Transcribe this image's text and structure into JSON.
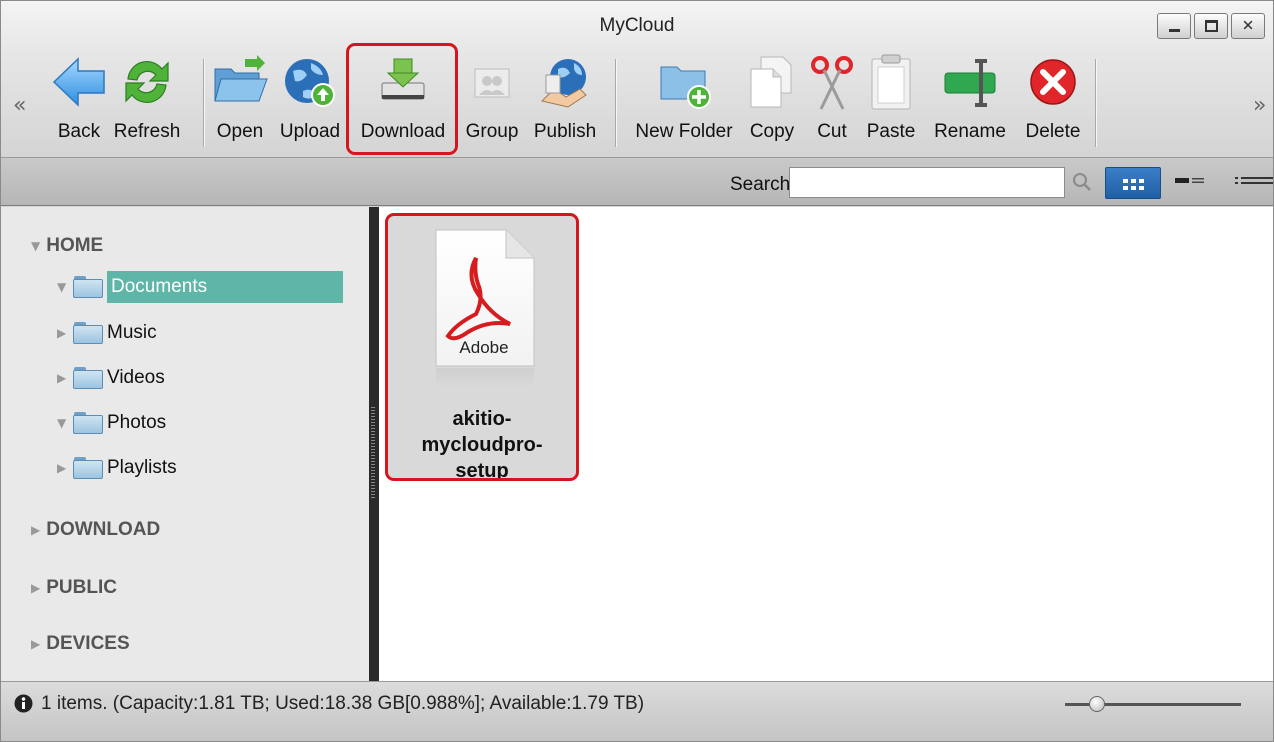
{
  "window": {
    "title": "MyCloud"
  },
  "toolbar": {
    "back": "Back",
    "refresh": "Refresh",
    "open": "Open",
    "upload": "Upload",
    "download": "Download",
    "group": "Group",
    "publish": "Publish",
    "new_folder": "New Folder",
    "copy": "Copy",
    "cut": "Cut",
    "paste": "Paste",
    "rename": "Rename",
    "delete": "Delete",
    "scroll_left": "«",
    "scroll_right": "»"
  },
  "search": {
    "label": "Search",
    "value": ""
  },
  "sidebar": {
    "home": "HOME",
    "items": [
      {
        "label": "Documents",
        "selected": true
      },
      {
        "label": "Music"
      },
      {
        "label": "Videos"
      },
      {
        "label": "Photos"
      },
      {
        "label": "Playlists"
      }
    ],
    "download": "DOWNLOAD",
    "public": "PUBLIC",
    "devices": "DEVICES"
  },
  "files": [
    {
      "name_line1": "akitio-",
      "name_line2": "mycloudpro-",
      "name_line3": "setup",
      "thumb_text": "Adobe",
      "icon": "pdf-icon"
    }
  ],
  "status": {
    "text": "1 items. (Capacity:1.81 TB; Used:18.38 GB[0.988%]; Available:1.79 TB)",
    "zoom_level_fraction": 0.18
  },
  "colors": {
    "highlight": "#d6161c",
    "selected_folder": "#5fb5a8",
    "view_button": "#2a6bb4"
  }
}
